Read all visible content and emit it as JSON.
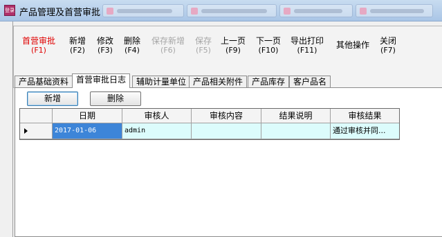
{
  "window": {
    "title": "产品管理及首营审批",
    "icon_text": "登录"
  },
  "toolbar": [
    {
      "label": "首营审批",
      "key": "(F1)",
      "state": "active"
    },
    {
      "label": "新增",
      "key": "(F2)",
      "state": "normal"
    },
    {
      "label": "修改",
      "key": "(F3)",
      "state": "normal"
    },
    {
      "label": "删除",
      "key": "(F4)",
      "state": "normal"
    },
    {
      "label": "保存新增",
      "key": "(F6)",
      "state": "disabled"
    },
    {
      "label": "保存",
      "key": "(F5)",
      "state": "disabled"
    },
    {
      "label": "上一页",
      "key": "(F9)",
      "state": "normal"
    },
    {
      "label": "下一页",
      "key": "(F10)",
      "state": "normal"
    },
    {
      "label": "导出打印",
      "key": "(F11)",
      "state": "normal"
    },
    {
      "label": "其他操作",
      "key": "",
      "state": "normal"
    },
    {
      "label": "关闭",
      "key": "(F7)",
      "state": "normal"
    }
  ],
  "tabs": [
    {
      "label": "产品基础资料",
      "selected": false
    },
    {
      "label": "首营审批日志",
      "selected": true
    },
    {
      "label": "辅助计量单位",
      "selected": false
    },
    {
      "label": "产品相关附件",
      "selected": false
    },
    {
      "label": "产品库存",
      "selected": false
    },
    {
      "label": "客户品名",
      "selected": false
    }
  ],
  "panel": {
    "add_button": "新增",
    "delete_button": "删除"
  },
  "grid": {
    "columns": [
      "日期",
      "审核人",
      "审核内容",
      "结果说明",
      "审核结果"
    ],
    "rows": [
      [
        "2017-01-06",
        "admin",
        "",
        "",
        "通过审核并同..."
      ]
    ]
  },
  "colors": {
    "active_text": "#e00000",
    "disabled_text": "#a6a6a6",
    "row_bg": "#dcfcfc",
    "selected_cell_bg": "#3d85d8"
  }
}
